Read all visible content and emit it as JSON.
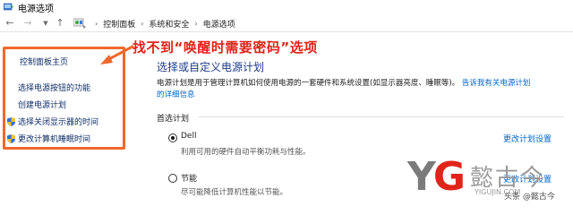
{
  "window": {
    "title": "电源选项"
  },
  "breadcrumbs": [
    "控制面板",
    "系统和安全",
    "电源选项"
  ],
  "leftnav": {
    "home": "控制面板主页",
    "items": [
      {
        "label": "选择电源按钮的功能",
        "icon": null
      },
      {
        "label": "创建电源计划",
        "icon": null
      },
      {
        "label": "选择关闭显示器的时间",
        "icon": "shield-icon"
      },
      {
        "label": "更改计算机睡眠时间",
        "icon": "shield-icon"
      }
    ]
  },
  "main": {
    "heading": "选择或自定义电源计划",
    "description": "电源计划是用于管理计算机如何使用电源的一套硬件和系统设置(如显示器亮度、睡眠等)。",
    "link1": "告诉我有关电源计划",
    "link2": "的详细信息",
    "section_label": "首选计划",
    "plans": [
      {
        "name": "Dell",
        "description": "利用可用的硬件自动平衡功耗与性能。",
        "selected": true,
        "change_label": "更改计划设置"
      },
      {
        "name": "节能",
        "description": "尽可能降低计算机性能以节能。",
        "selected": false,
        "change_label": "更改计划设置"
      }
    ]
  },
  "annotation": {
    "text": "找不到“唤醒时需要密码”选项",
    "color": "#e2231a",
    "box_color": "#f0682b"
  },
  "watermark": {
    "logo": "YG",
    "chinese": "懿古今",
    "sub": "YIGUJIN.COM",
    "credit": "头条 @懿古今"
  }
}
